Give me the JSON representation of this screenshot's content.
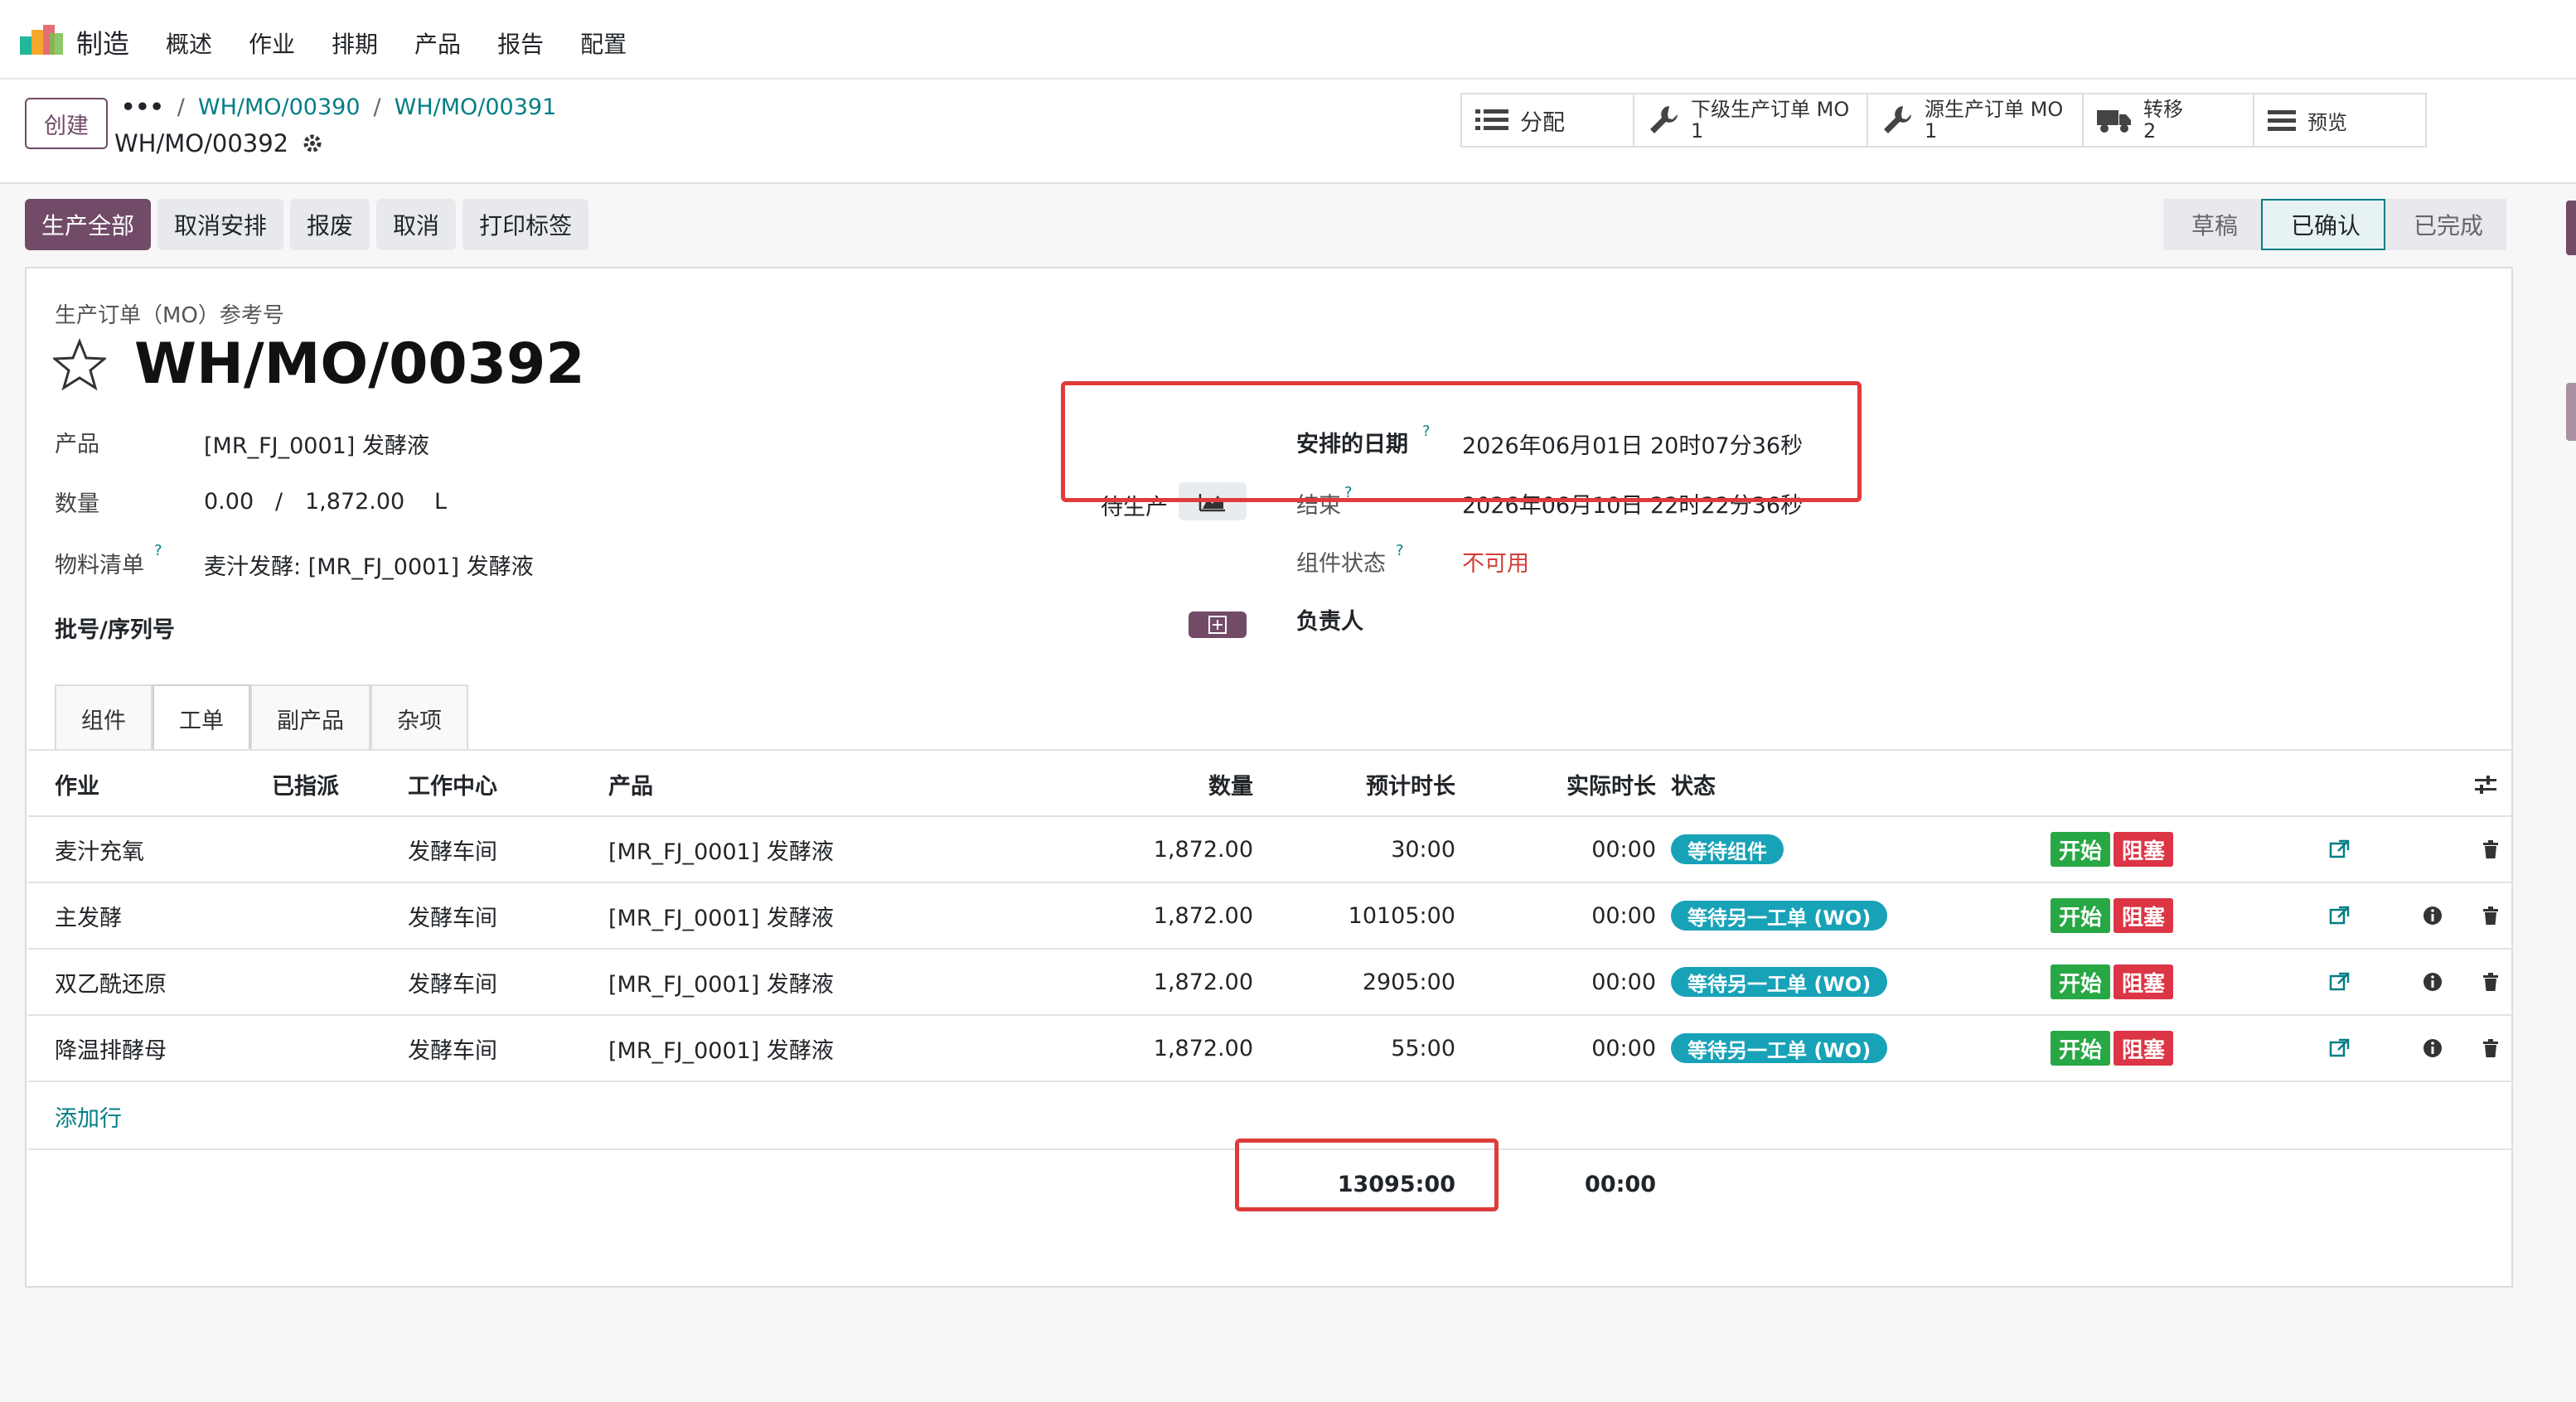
{
  "navbar": {
    "app": "制造",
    "menu": [
      "概述",
      "作业",
      "排期",
      "产品",
      "报告",
      "配置"
    ]
  },
  "control": {
    "create": "创建",
    "breadcrumb": [
      "WH/MO/00390",
      "WH/MO/00391"
    ],
    "record": "WH/MO/00392",
    "smart_buttons": [
      {
        "label": "分配",
        "count": "",
        "icon": "list-icon"
      },
      {
        "label": "下级生产订单 MO",
        "count": "1",
        "icon": "wrench-icon"
      },
      {
        "label": "源生产订单 MO",
        "count": "1",
        "icon": "wrench-icon"
      },
      {
        "label": "转移",
        "count": "2",
        "icon": "truck-icon"
      },
      {
        "label": "预览",
        "count": "",
        "icon": "menu-icon"
      }
    ]
  },
  "actions": [
    "生产全部",
    "取消安排",
    "报废",
    "取消",
    "打印标签"
  ],
  "stages": [
    "草稿",
    "已确认",
    "已完成"
  ],
  "form": {
    "ref_label": "生产订单（MO）参考号",
    "title": "WH/MO/00392",
    "product_label": "产品",
    "product_value": "[MR_FJ_0001] 发酵液",
    "qty_label": "数量",
    "qty_done": "0.00",
    "qty_slash": "/",
    "qty_total": "1,872.00",
    "qty_uom": "L",
    "bom_label": "物料清单",
    "bom_value": "麦汁发酵: [MR_FJ_0001] 发酵液",
    "lot_label": "批号/序列号",
    "state_label": "待生产",
    "sched_label": "安排的日期",
    "sched_value": "2026年06月01日 20时07分36秒",
    "end_label": "结束",
    "end_value": "2026年06月10日 22时22分36秒",
    "comp_label": "组件状态",
    "comp_value": "不可用",
    "resp_label": "负责人",
    "help_mark": "?"
  },
  "tabs": [
    "组件",
    "工单",
    "副产品",
    "杂项"
  ],
  "table": {
    "headers": {
      "op": "作业",
      "assigned": "已指派",
      "wc": "工作中心",
      "product": "产品",
      "qty": "数量",
      "expected": "预计时长",
      "real": "实际时长",
      "status": "状态"
    },
    "rows": [
      {
        "op": "麦汁充氧",
        "wc": "发酵车间",
        "product": "[MR_FJ_0001] 发酵液",
        "qty": "1,872.00",
        "expected": "30:00",
        "real": "00:00",
        "status": "等待组件",
        "info": false
      },
      {
        "op": "主发酵",
        "wc": "发酵车间",
        "product": "[MR_FJ_0001] 发酵液",
        "qty": "1,872.00",
        "expected": "10105:00",
        "real": "00:00",
        "status": "等待另一工单 (WO)",
        "info": true
      },
      {
        "op": "双乙酰还原",
        "wc": "发酵车间",
        "product": "[MR_FJ_0001] 发酵液",
        "qty": "1,872.00",
        "expected": "2905:00",
        "real": "00:00",
        "status": "等待另一工单 (WO)",
        "info": true
      },
      {
        "op": "降温排酵母",
        "wc": "发酵车间",
        "product": "[MR_FJ_0001] 发酵液",
        "qty": "1,872.00",
        "expected": "55:00",
        "real": "00:00",
        "status": "等待另一工单 (WO)",
        "info": true
      }
    ],
    "start": "开始",
    "block": "阻塞",
    "add_line": "添加行",
    "total_expected": "13095:00",
    "total_real": "00:00"
  },
  "colors": {
    "primary": "#714b67",
    "link": "#017e84",
    "badge": "#17a2b8",
    "red": "#e03b3b"
  }
}
